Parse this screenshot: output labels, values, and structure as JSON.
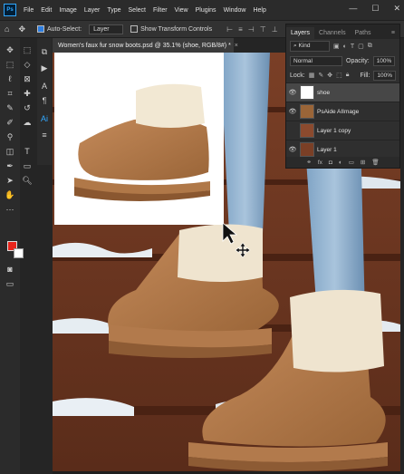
{
  "app": {
    "logo": "Ps"
  },
  "menu": [
    "File",
    "Edit",
    "Image",
    "Layer",
    "Type",
    "Select",
    "Filter",
    "View",
    "Plugins",
    "Window",
    "Help"
  ],
  "window_controls": {
    "minimize": "—",
    "maximize": "☐",
    "close": "✕"
  },
  "options_bar": {
    "auto_select_label": "Auto-Select:",
    "auto_select_value": "Layer",
    "transform_controls_label": "Show Transform Controls"
  },
  "document": {
    "tab_title": "Women's faux fur snow boots.psd @ 35.1% (shoe, RGB/8#) *",
    "tab_close": "×"
  },
  "layers_panel": {
    "tabs": [
      "Layers",
      "Channels",
      "Paths"
    ],
    "filter_value": "Kind",
    "blend_mode": "Normal",
    "opacity_label": "Opacity:",
    "opacity_value": "100%",
    "lock_label": "Lock:",
    "fill_label": "Fill:",
    "fill_value": "100%",
    "layers": [
      {
        "name": "shoe",
        "selected": true,
        "visible": true
      },
      {
        "name": "PsAide AIImage",
        "selected": false,
        "visible": true
      },
      {
        "name": "Layer 1 copy",
        "selected": false,
        "visible": false
      },
      {
        "name": "Layer 1",
        "selected": false,
        "visible": true
      }
    ],
    "footer_fx": "fx"
  },
  "colors": {
    "foreground": "#e8251c",
    "background": "#ffffff",
    "accent": "#2d7de0"
  },
  "icons": [
    "move-icon",
    "marquee-icon",
    "lasso-icon",
    "crop-icon",
    "eyedropper-icon",
    "brush-icon",
    "stamp-icon",
    "eraser-icon",
    "gradient-icon",
    "pen-icon",
    "type-icon",
    "select-icon",
    "shape-icon",
    "hand-icon",
    "zoom-icon"
  ]
}
